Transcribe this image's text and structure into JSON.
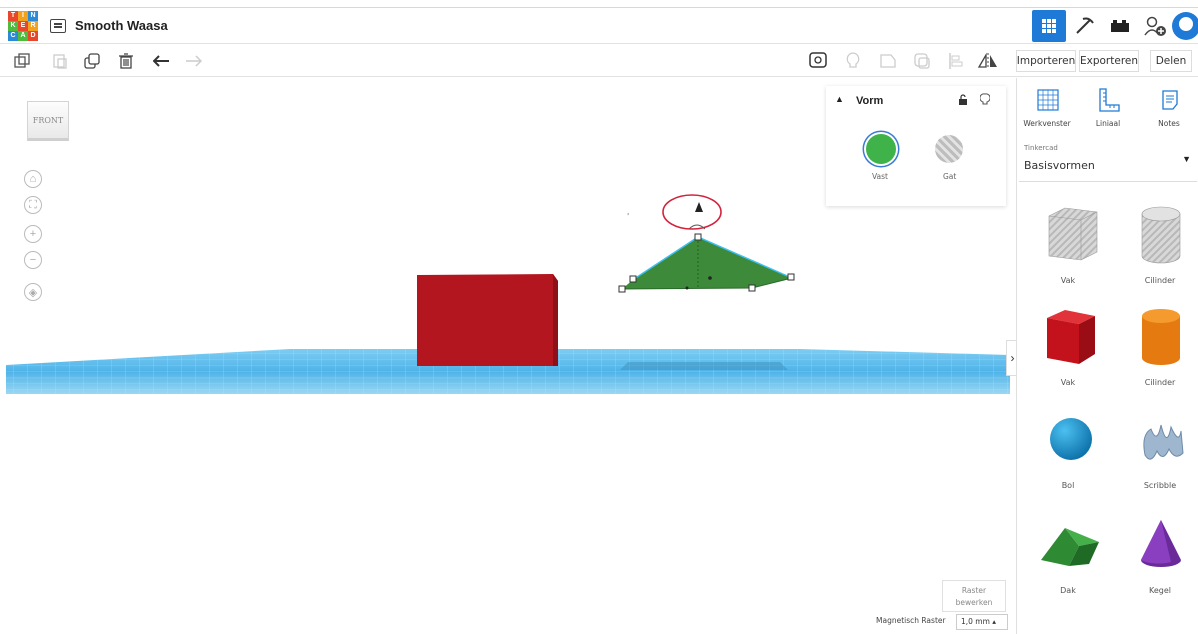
{
  "header": {
    "logo_letters": [
      "T",
      "I",
      "N",
      "K",
      "E",
      "R",
      "C",
      "A",
      "D"
    ],
    "title": "Smooth Waasa"
  },
  "toolbar": {
    "import_label": "Importeren",
    "export_label": "Exporteren",
    "share_label": "Delen"
  },
  "viewcube_label": "FRONT",
  "shape_panel": {
    "title": "Vorm",
    "solid_label": "Vast",
    "hole_label": "Gat",
    "solid_color": "#3fb34a"
  },
  "sidebar": {
    "tools": [
      {
        "label": "Werkvenster",
        "icon": "workplane-icon"
      },
      {
        "label": "Liniaal",
        "icon": "ruler-icon"
      },
      {
        "label": "Notes",
        "icon": "notes-icon"
      }
    ],
    "library_provider": "Tinkercad",
    "library_selected": "Basisvormen",
    "shapes": [
      {
        "name": "Vak",
        "icon": "box-striped-icon"
      },
      {
        "name": "Cilinder",
        "icon": "cylinder-striped-icon"
      },
      {
        "name": "Vak",
        "icon": "box-red-icon"
      },
      {
        "name": "Cilinder",
        "icon": "cylinder-orange-icon"
      },
      {
        "name": "Bol",
        "icon": "sphere-icon"
      },
      {
        "name": "Scribble",
        "icon": "scribble-icon"
      },
      {
        "name": "Dak",
        "icon": "roof-icon"
      },
      {
        "name": "Kegel",
        "icon": "cone-icon"
      }
    ]
  },
  "grid": {
    "edit_line1": "Raster",
    "edit_line2": "bewerken",
    "snap_label": "Magnetisch Raster",
    "snap_value": "1,0 mm ▴"
  },
  "colors": {
    "accent": "#1e7ad6",
    "box_red": "#b3161f",
    "roof_green": "#3c8a3a",
    "workplane_blue": "#4fb3e8",
    "annotation_red": "#d2233c"
  }
}
